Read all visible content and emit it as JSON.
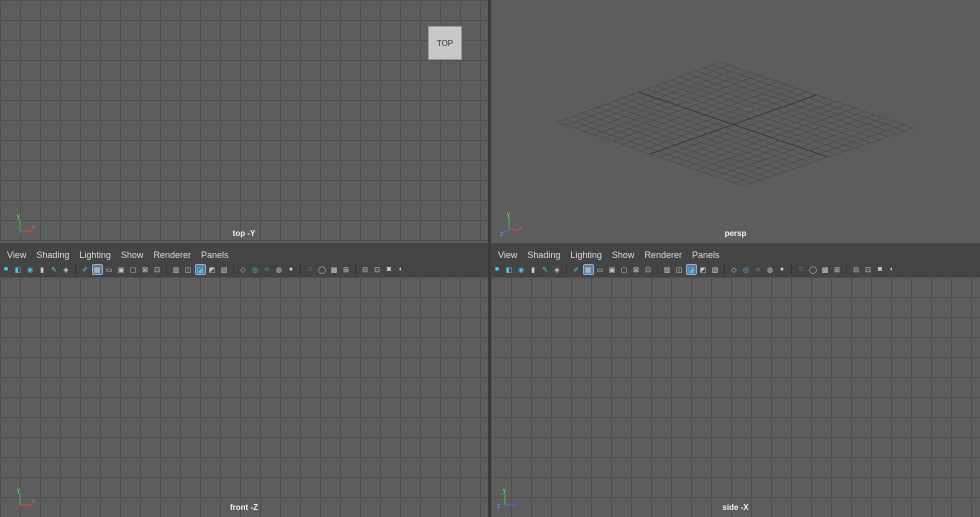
{
  "viewports": {
    "top": {
      "label": "top -Y",
      "cube_label": "TOP"
    },
    "persp": {
      "label": "persp"
    },
    "front": {
      "label": "front -Z"
    },
    "side": {
      "label": "side -X"
    }
  },
  "menu": [
    "View",
    "Shading",
    "Lighting",
    "Show",
    "Renderer",
    "Panels"
  ],
  "axis_labels": {
    "x": "x",
    "y": "y",
    "z": "z"
  },
  "toolbar_icons": [
    "camera-icon",
    "camera-lock-icon",
    "bookmark-icon",
    "image-plane-icon",
    "grid-icon",
    "film-gate-icon",
    "resolution-gate-icon",
    "safe-area-icon",
    "wireframe-icon",
    "shaded-icon",
    "xray-icon",
    "lights-icon",
    "shadows-icon",
    "isolate-icon",
    "frame-icon",
    "render-icon"
  ],
  "colors": {
    "accent": "#4fc7e6",
    "viewport_bg": "#5d5d5d",
    "grid": "#4f4f4f"
  }
}
